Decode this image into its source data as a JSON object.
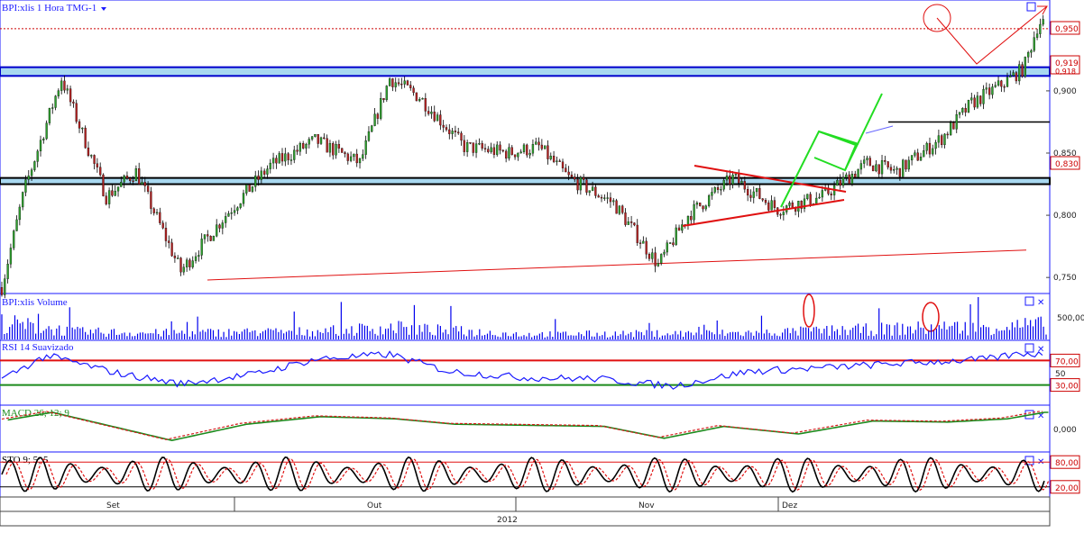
{
  "colors": {
    "bg": "#ffffff",
    "frame": "#1a1aff",
    "volume": "#0000ee",
    "rsi": "#1a1aff",
    "macd": "#d41c1c",
    "signal": "#1c8a1c",
    "stoch_k": "#000000",
    "stoch_d": "#e01010",
    "resistance_fill": "#a8d8f0",
    "annotation_red": "#e01010",
    "annotation_green": "#22dd22"
  },
  "chart_data": [
    {
      "type": "candlestick",
      "title": "BPI:xlis 1 Hora TMG-1",
      "price_labels": [
        "0,950",
        "0,919",
        "0,918",
        "0,830"
      ],
      "ylim": [
        0.74,
        0.96
      ],
      "yticks": [
        "0,900",
        "0,850",
        "0,800",
        "0,750"
      ],
      "ytick_values": [
        0.9,
        0.85,
        0.8,
        0.75
      ],
      "x_labels": [
        "Set",
        "Out",
        "Nov",
        "Dez"
      ],
      "x_year": "2012",
      "key_points": [
        [
          0,
          0.742
        ],
        [
          3,
          0.82
        ],
        [
          8,
          0.91
        ],
        [
          14,
          0.815
        ],
        [
          18,
          0.835
        ],
        [
          24,
          0.755
        ],
        [
          30,
          0.8
        ],
        [
          36,
          0.84
        ],
        [
          42,
          0.86
        ],
        [
          48,
          0.842
        ],
        [
          52,
          0.91
        ],
        [
          56,
          0.895
        ],
        [
          62,
          0.855
        ],
        [
          68,
          0.85
        ],
        [
          72,
          0.855
        ],
        [
          76,
          0.83
        ],
        [
          82,
          0.81
        ],
        [
          88,
          0.76
        ],
        [
          92,
          0.8
        ],
        [
          98,
          0.83
        ],
        [
          104,
          0.805
        ],
        [
          110,
          0.815
        ],
        [
          116,
          0.842
        ],
        [
          120,
          0.835
        ],
        [
          126,
          0.862
        ],
        [
          130,
          0.89
        ],
        [
          134,
          0.905
        ],
        [
          137,
          0.918
        ],
        [
          139,
          0.955
        ]
      ],
      "levels": {
        "resistance_band": [
          0.912,
          0.919
        ],
        "support_band": [
          0.825,
          0.83
        ],
        "dotted_level": 0.95,
        "minor_level": 0.875
      },
      "trendline": [
        [
          0.748,
          0
        ],
        [
          0.772,
          1
        ]
      ]
    },
    {
      "type": "bar",
      "title": "BPI:xlis Volume",
      "ytick": "500,00",
      "ymax": 1000,
      "key_points": [
        [
          0,
          0.65
        ],
        [
          10,
          0.3
        ],
        [
          20,
          0.25
        ],
        [
          40,
          0.3
        ],
        [
          52,
          0.45
        ],
        [
          70,
          0.2
        ],
        [
          100,
          0.25
        ],
        [
          118,
          0.4
        ],
        [
          139,
          0.55
        ]
      ]
    },
    {
      "type": "line",
      "title": "RSI 14 Suavizado",
      "ylim": [
        0,
        100
      ],
      "levels": [
        "70,00",
        "50",
        "30,00"
      ],
      "level_values": [
        70,
        50,
        30
      ],
      "key_points": [
        [
          0,
          40
        ],
        [
          6,
          78
        ],
        [
          16,
          48
        ],
        [
          24,
          32
        ],
        [
          34,
          48
        ],
        [
          42,
          72
        ],
        [
          52,
          80
        ],
        [
          60,
          52
        ],
        [
          70,
          42
        ],
        [
          80,
          40
        ],
        [
          90,
          28
        ],
        [
          100,
          52
        ],
        [
          110,
          58
        ],
        [
          120,
          65
        ],
        [
          132,
          72
        ],
        [
          137,
          82
        ],
        [
          139,
          80
        ]
      ]
    },
    {
      "type": "line",
      "title": "MACD 26; 12; 9",
      "ylim": [
        -1,
        1
      ],
      "ytick": "0,000",
      "key_points": [
        [
          0,
          0.4
        ],
        [
          6,
          0.75
        ],
        [
          14,
          0.1
        ],
        [
          22,
          -0.55
        ],
        [
          32,
          0.2
        ],
        [
          42,
          0.55
        ],
        [
          52,
          0.45
        ],
        [
          60,
          0.2
        ],
        [
          70,
          0.15
        ],
        [
          80,
          0.1
        ],
        [
          88,
          -0.45
        ],
        [
          96,
          0.1
        ],
        [
          106,
          -0.25
        ],
        [
          116,
          0.35
        ],
        [
          126,
          0.3
        ],
        [
          134,
          0.45
        ],
        [
          139,
          0.75
        ]
      ]
    },
    {
      "type": "line",
      "title": "STO 9; 5; 5",
      "ylim": [
        0,
        100
      ],
      "levels": [
        "80,00",
        "20,00"
      ],
      "level_values": [
        80,
        20
      ],
      "cycles": 34
    }
  ]
}
